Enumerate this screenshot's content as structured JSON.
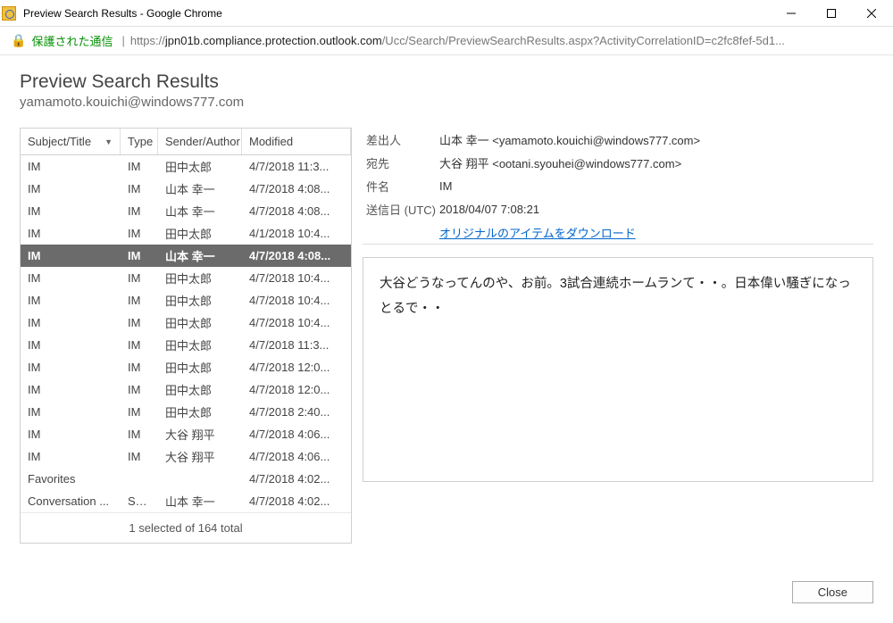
{
  "window": {
    "title": "Preview Search Results - Google Chrome"
  },
  "address": {
    "secure_label": "保護された通信",
    "url_prefix": "https://",
    "url_host": "jpn01b.compliance.protection.outlook.com",
    "url_rest": "/Ucc/Search/PreviewSearchResults.aspx?ActivityCorrelationID=c2fc8fef-5d1..."
  },
  "header": {
    "title": "Preview Search Results",
    "subtitle": "yamamoto.kouichi@windows777.com"
  },
  "columns": {
    "subject": "Subject/Title",
    "type": "Type",
    "sender": "Sender/Author",
    "modified": "Modified"
  },
  "rows": [
    {
      "subject": "IM",
      "type": "IM",
      "sender": "田中太郎",
      "modified": "4/7/2018 11:3...",
      "sel": false
    },
    {
      "subject": "IM",
      "type": "IM",
      "sender": "山本 幸一",
      "modified": "4/7/2018 4:08...",
      "sel": false
    },
    {
      "subject": "IM",
      "type": "IM",
      "sender": "山本 幸一",
      "modified": "4/7/2018 4:08...",
      "sel": false
    },
    {
      "subject": "IM",
      "type": "IM",
      "sender": "田中太郎",
      "modified": "4/1/2018 10:4...",
      "sel": false
    },
    {
      "subject": "IM",
      "type": "IM",
      "sender": "山本 幸一",
      "modified": "4/7/2018 4:08...",
      "sel": true
    },
    {
      "subject": "IM",
      "type": "IM",
      "sender": "田中太郎",
      "modified": "4/7/2018 10:4...",
      "sel": false
    },
    {
      "subject": "IM",
      "type": "IM",
      "sender": "田中太郎",
      "modified": "4/7/2018 10:4...",
      "sel": false
    },
    {
      "subject": "IM",
      "type": "IM",
      "sender": "田中太郎",
      "modified": "4/7/2018 10:4...",
      "sel": false
    },
    {
      "subject": "IM",
      "type": "IM",
      "sender": "田中太郎",
      "modified": "4/7/2018 11:3...",
      "sel": false
    },
    {
      "subject": "IM",
      "type": "IM",
      "sender": "田中太郎",
      "modified": "4/7/2018 12:0...",
      "sel": false
    },
    {
      "subject": "IM",
      "type": "IM",
      "sender": "田中太郎",
      "modified": "4/7/2018 12:0...",
      "sel": false
    },
    {
      "subject": "IM",
      "type": "IM",
      "sender": "田中太郎",
      "modified": "4/7/2018 2:40...",
      "sel": false
    },
    {
      "subject": "IM",
      "type": "IM",
      "sender": "大谷 翔平",
      "modified": "4/7/2018 4:06...",
      "sel": false
    },
    {
      "subject": "IM",
      "type": "IM",
      "sender": "大谷 翔平",
      "modified": "4/7/2018 4:06...",
      "sel": false
    },
    {
      "subject": "Favorites",
      "type": "",
      "sender": "",
      "modified": "4/7/2018 4:02...",
      "sel": false
    },
    {
      "subject": "Conversation ...",
      "type": "Sky...",
      "sender": "山本 幸一",
      "modified": "4/7/2018 4:02...",
      "sel": false
    }
  ],
  "footer_status": "1 selected of 164 total",
  "details": {
    "from_label": "差出人",
    "from_value": "山本 幸一 <yamamoto.kouichi@windows777.com>",
    "to_label": "宛先",
    "to_value": "大谷 翔平 <ootani.syouhei@windows777.com>",
    "subject_label": "件名",
    "subject_value": "IM",
    "sent_label": "送信日 (UTC)",
    "sent_value": "2018/04/07 7:08:21",
    "download_label": "オリジナルのアイテムをダウンロード"
  },
  "body": "大谷どうなってんのや、お前。3試合連続ホームランて・・。日本偉い騒ぎになっとるで・・",
  "buttons": {
    "close": "Close"
  }
}
